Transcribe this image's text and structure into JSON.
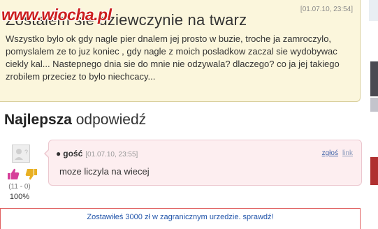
{
  "watermark": "www.wiocha.pl",
  "question": {
    "date": "[01.07.10, 23:54]",
    "title": "Zostalem sie dziewczynie na twarz",
    "body": "Wszystko bylo ok gdy nagle pier dnalem jej prosto w buzie, troche ja zamroczylo, pomyslalem ze to juz koniec , gdy nagle z moich posladkow zaczal sie wydobywac ciekly kal... Nastepnego dnia sie do mnie nie odzywala? dlaczego? co ja jej takiego zrobilem przeciez to bylo niechcacy..."
  },
  "best_answer": {
    "heading_bold": "Najlepsza",
    "heading_rest": " odpowiedź",
    "author": "gość",
    "date": "[01.07.10, 23:55]",
    "text": "moze liczyla na wiecej",
    "report_link": "zgłoś",
    "link_link": "link",
    "votes": "(11 - 0)",
    "percent": "100%"
  },
  "banner": {
    "text": "Zostawiłeś 3000 zł w zagranicznym urzedzie. sprawdź!"
  },
  "colors": {
    "question_bg": "#fbf6dc",
    "answer_bg": "#fdeef0",
    "link": "#4466aa",
    "watermark": "#cc1f1f",
    "thumb_up": "#d63f9a",
    "thumb_down": "#e8b023"
  }
}
